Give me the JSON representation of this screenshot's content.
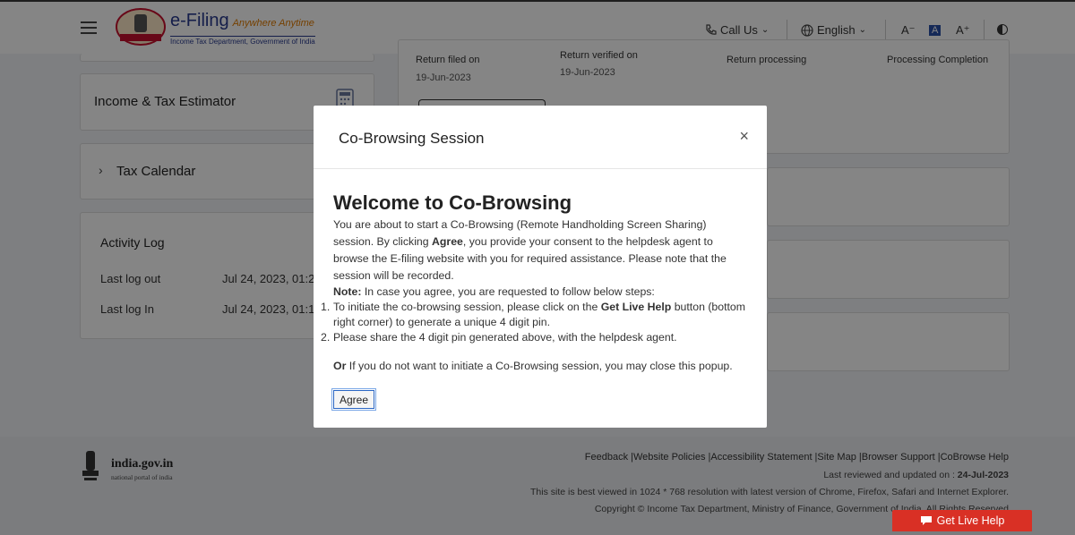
{
  "header": {
    "logo_title": "e-Filing",
    "logo_tagline": "Anywhere Anytime",
    "logo_subtitle": "Income Tax Department, Government of India",
    "emblem_label": "INCOME TAX DEPARTMENT",
    "call_us": "Call Us",
    "language": "English",
    "font_decrease": "A⁻",
    "font_normal": "A",
    "font_increase": "A⁺"
  },
  "timeline": {
    "steps": [
      {
        "label": "Return filed on",
        "date": "19-Jun-2023"
      },
      {
        "label": "Return verified on",
        "date": "19-Jun-2023"
      },
      {
        "label": "Return processing",
        "date": ""
      },
      {
        "label": "Processing Completion",
        "date": ""
      }
    ]
  },
  "sidebar": {
    "estimator_title": "Income & Tax Estimator",
    "calendar_title": "Tax Calendar",
    "activity_title": "Activity Log",
    "activity_rows": [
      {
        "label": "Last log out",
        "value": "Jul 24, 2023, 01:2"
      },
      {
        "label": "Last log In",
        "value": "Jul 24, 2023, 01:1"
      }
    ]
  },
  "footer": {
    "portal_name": "india.gov.in",
    "portal_sub": "national portal of india",
    "links": "Feedback |Website Policies |Accessibility Statement |Site Map |Browser Support |CoBrowse Help",
    "reviewed_label": "Last reviewed and updated on : ",
    "reviewed_date": "24-Jul-2023",
    "best_viewed": "This site is best viewed in 1024 * 768 resolution with latest version of Chrome, Firefox, Safari and Internet Explorer.",
    "copyright": "Copyright © Income Tax Department, Ministry of Finance, Government of India. All Rights Reserved"
  },
  "modal": {
    "title": "Co-Browsing Session",
    "close": "×",
    "heading": "Welcome to Co-Browsing",
    "intro_1": "You are about to start a Co-Browsing (Remote Handholding Screen Sharing) session. By clicking ",
    "intro_bold": "Agree",
    "intro_2": ", you provide your consent to the helpdesk agent to browse the E-filing website with you for required assistance. Please note that the session will be recorded.",
    "note_label": "Note:",
    "note_text": " In case you agree, you are requested to follow below steps:",
    "step1_num": "1.",
    "step1_a": "To initiate the co-browsing session, please click on the ",
    "step1_bold": "Get Live Help",
    "step1_b": " button (bottom right corner) to generate a unique 4 digit pin.",
    "step2_num": "2.",
    "step2": "Please share the 4 digit pin generated above, with the helpdesk agent.",
    "or_label": "Or",
    "or_text": " If you do not want to initiate a Co-Browsing session, you may close this popup.",
    "agree_button": "Agree"
  },
  "live_help": {
    "label": "Get Live Help"
  }
}
